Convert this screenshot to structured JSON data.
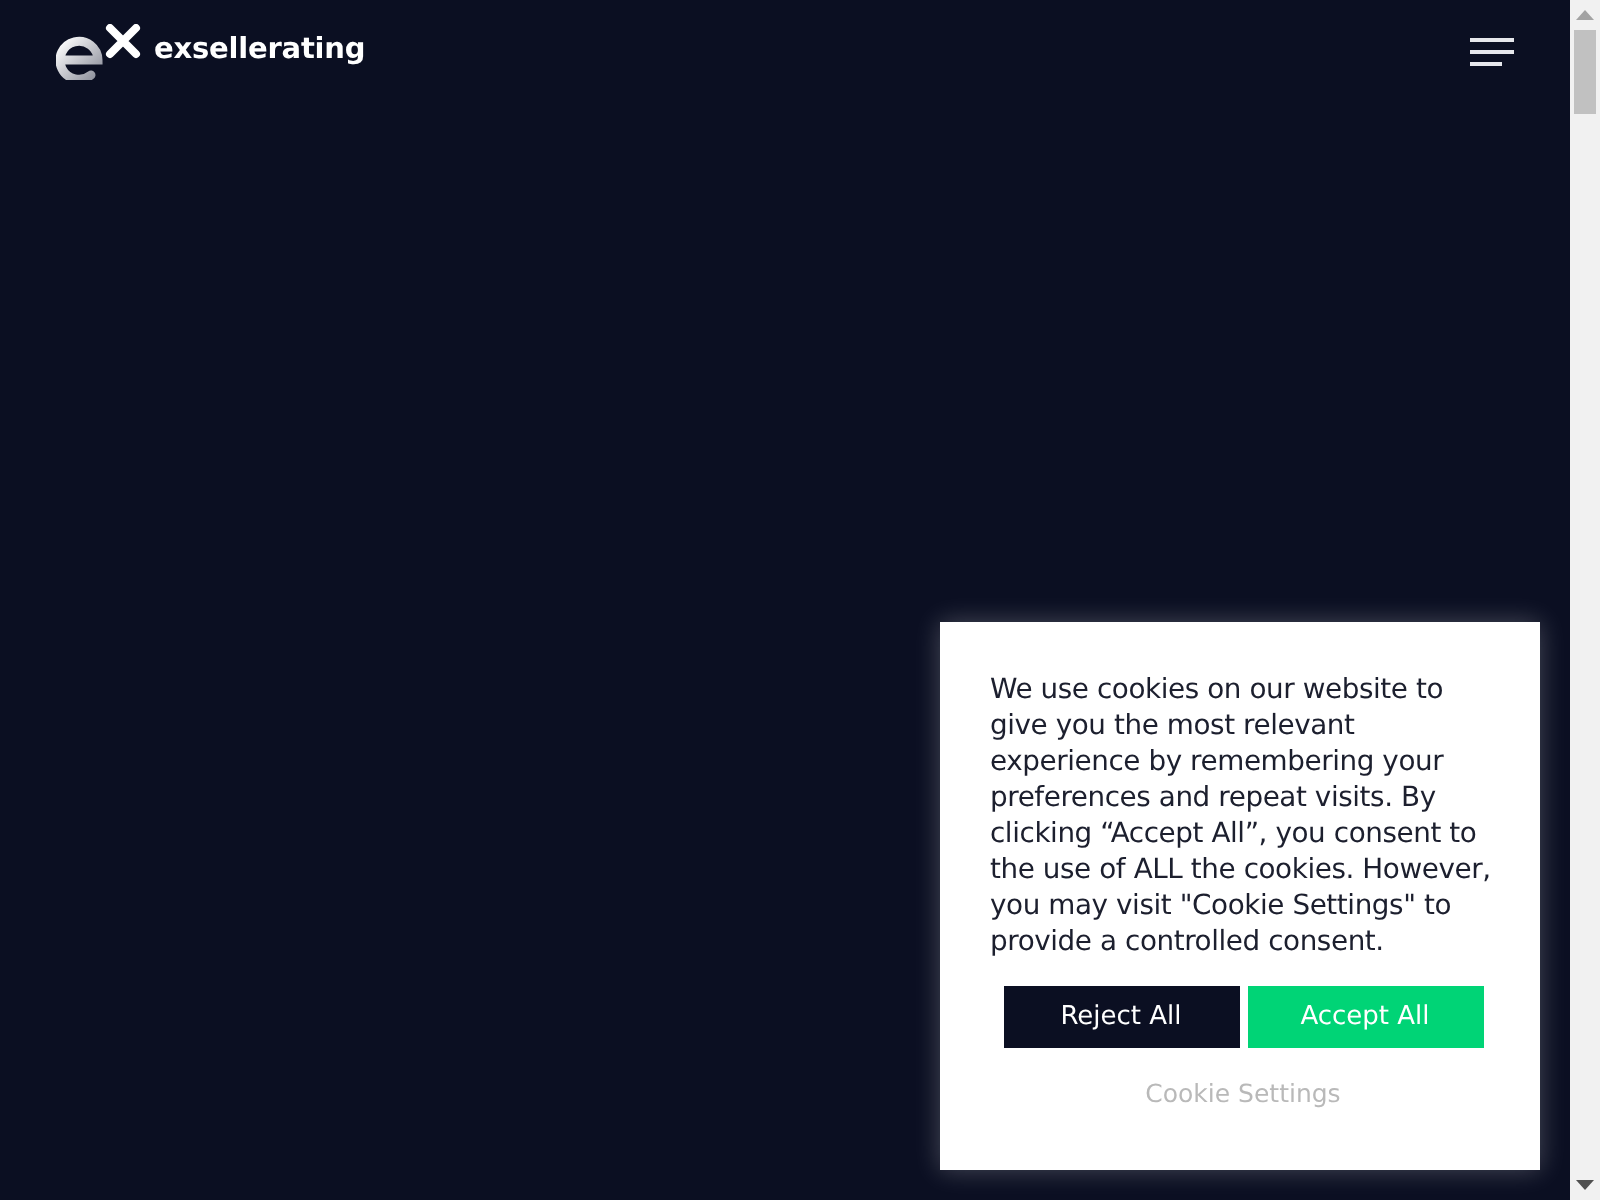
{
  "header": {
    "brand": "exsellerating"
  },
  "cookie_banner": {
    "message": "We use cookies on our website to give you the most relevant experience by remembering your preferences and repeat visits. By clicking “Accept All”, you consent to the use of ALL the cookies. However, you may visit \"Cookie Settings\" to provide a controlled consent.",
    "buttons": [
      {
        "label": "Reject All",
        "kind": "reject"
      },
      {
        "label": "Accept All",
        "kind": "accept"
      }
    ],
    "settings_link": "Cookie Settings"
  }
}
